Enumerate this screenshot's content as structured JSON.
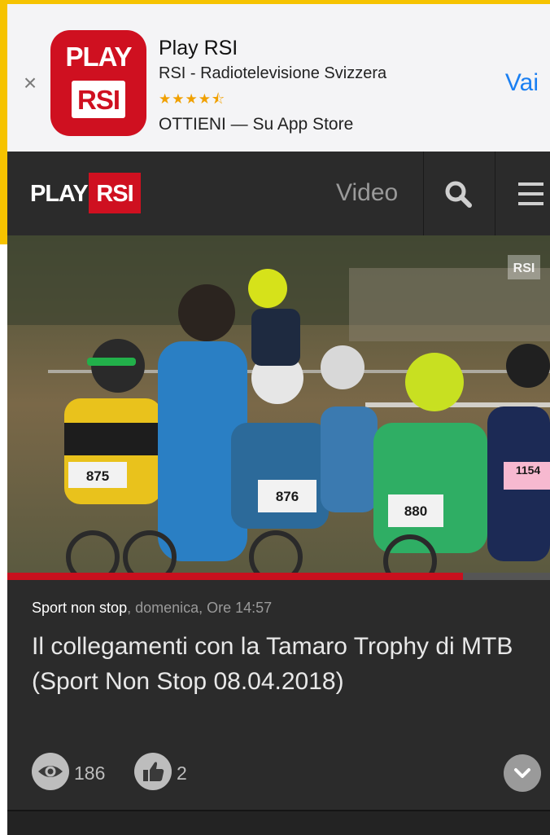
{
  "banner": {
    "close_glyph": "×",
    "icon_line1": "PLAY",
    "icon_line2": "RSI",
    "app_name": "Play RSI",
    "publisher": "RSI - Radiotelevisione Svizzera",
    "rating_stars": "★★★★⯪",
    "get_text": "OTTIENI — Su App Store",
    "open_label": "Vai"
  },
  "header": {
    "logo_play": "PLAY",
    "logo_rsi": "RSI",
    "nav_label": "Video",
    "search_icon": "search-icon",
    "menu_icon": "hamburger-icon"
  },
  "video": {
    "watermark": "RSI",
    "progress": 0.84,
    "bib_numbers": [
      "875",
      "876",
      "880",
      "1154"
    ]
  },
  "info": {
    "program": "Sport non stop",
    "meta_rest": ", domenica, Ore 14:57",
    "title": "Il collegamenti con la Tamaro Trophy di MTB (Sport Non Stop 08.04.2018)",
    "views": "186",
    "likes": "2"
  },
  "colors": {
    "frame": "#f6c300",
    "brand_red": "#cf1020",
    "link_blue": "#1a7ff2",
    "header_bg": "#2b2b2b"
  }
}
